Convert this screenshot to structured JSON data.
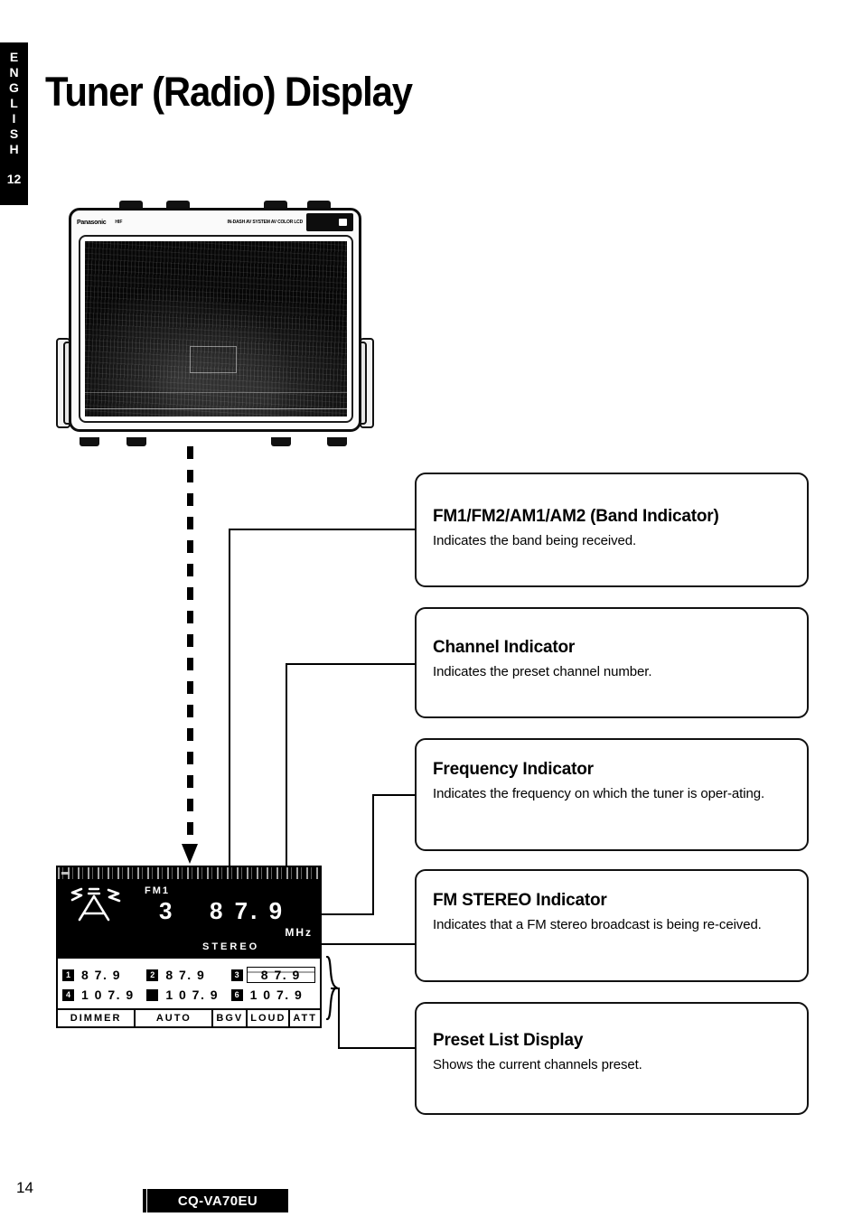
{
  "side_tab": {
    "language": "ENGLISH",
    "letters": [
      "E",
      "N",
      "G",
      "L",
      "I",
      "S",
      "H"
    ],
    "section_number": "12"
  },
  "header": {
    "title": "Tuner (Radio) Display"
  },
  "head_unit": {
    "brand": "Panasonic",
    "model_mark": "HIF",
    "system_line": "IN-DASH AV SYSTEM AV COLOR LCD",
    "screen_state": "video / noise"
  },
  "lcd": {
    "band": "FM1",
    "channel": "3",
    "frequency": "8 7.  9",
    "unit": "MHz",
    "stereo": "STEREO",
    "antenna_icon": "broadcast-antenna-icon",
    "presets": [
      {
        "number": "1",
        "frequency": "8 7. 9",
        "selected": false
      },
      {
        "number": "2",
        "frequency": "8 7. 9",
        "selected": false
      },
      {
        "number": "3",
        "frequency": "8 7. 9",
        "selected": true
      },
      {
        "number": "4",
        "frequency": "1 0 7. 9",
        "selected": false
      },
      {
        "number": "",
        "frequency": "1 0 7. 9",
        "selected": false
      },
      {
        "number": "6",
        "frequency": "1 0 7. 9",
        "selected": false
      }
    ],
    "status_bar": [
      "DIMMER",
      "AUTO",
      "BGV",
      "LOUD",
      "ATT"
    ]
  },
  "callouts": [
    {
      "title": "FM1/FM2/AM1/AM2 (Band Indicator)",
      "body": "Indicates the band being received."
    },
    {
      "title": "Channel Indicator",
      "body": "Indicates the preset channel number."
    },
    {
      "title": "Frequency Indicator",
      "body": "Indicates the frequency on which the tuner is oper-ating."
    },
    {
      "title": "FM STEREO Indicator",
      "body": "Indicates that a FM stereo broadcast is being re-ceived."
    },
    {
      "title": "Preset List Display",
      "body": "Shows the current channels preset."
    }
  ],
  "footer": {
    "page_number": "14",
    "model": "CQ-VA70EU"
  },
  "colors": {
    "ink": "#000000",
    "paper": "#ffffff"
  }
}
